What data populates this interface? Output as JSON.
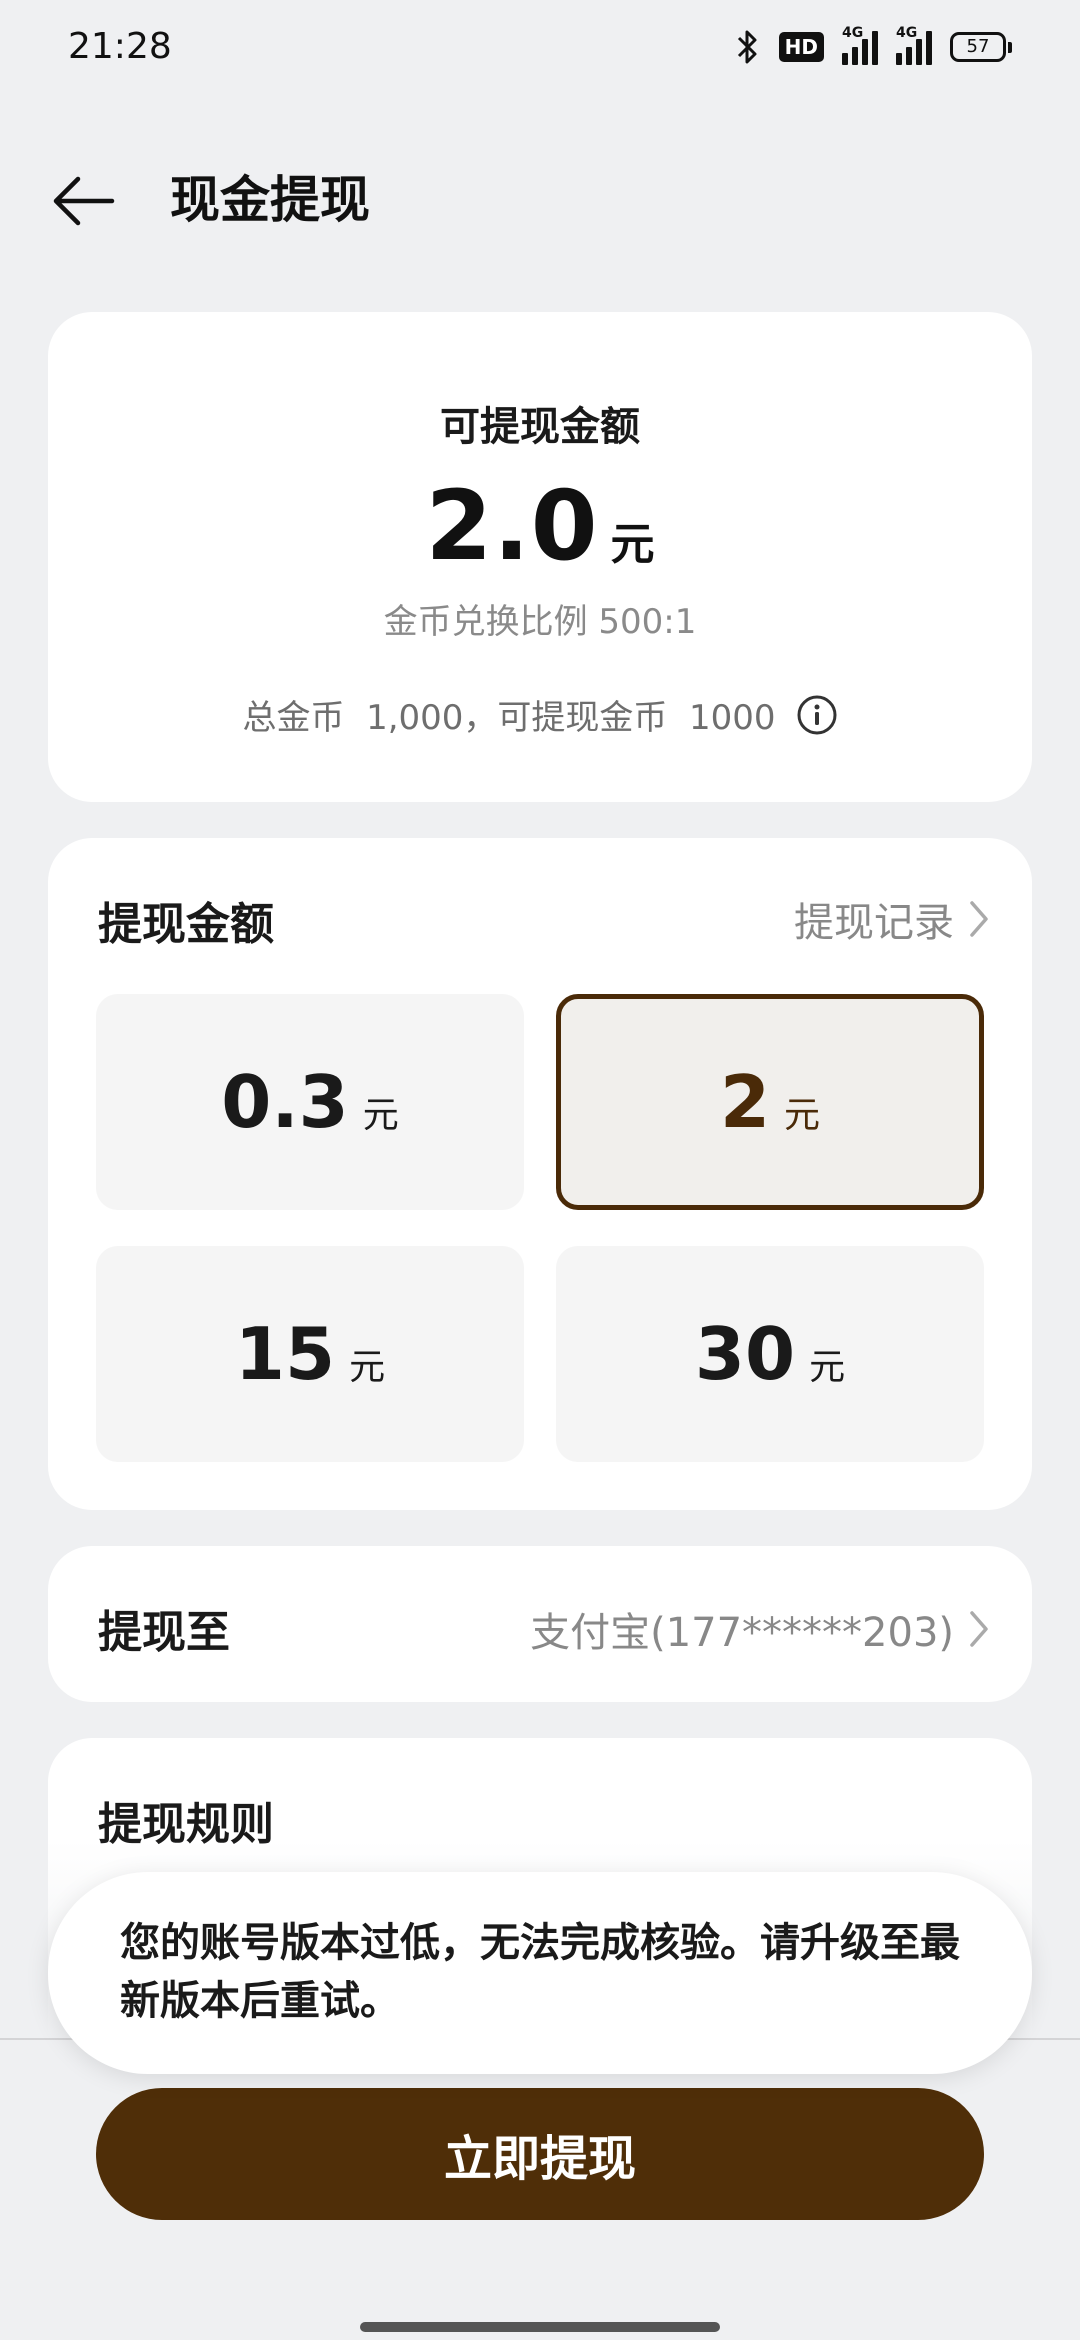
{
  "status_bar": {
    "time": "21:28",
    "hd_label": "HD",
    "net1": "4G",
    "net2": "4G",
    "battery": "57"
  },
  "header": {
    "title": "现金提现",
    "back_icon": "arrow-left-icon"
  },
  "balance": {
    "label": "可提现金额",
    "amount": "2.0",
    "unit": "元",
    "rate": "金币兑换比例 500:1",
    "coins_text": "总金币  1,000，可提现金币  1000",
    "info_icon": "info-icon"
  },
  "amount_section": {
    "title": "提现金额",
    "history_link": "提现记录",
    "options": [
      {
        "value": "0.3",
        "unit": "元",
        "selected": false
      },
      {
        "value": "2",
        "unit": "元",
        "selected": true
      },
      {
        "value": "15",
        "unit": "元",
        "selected": false
      },
      {
        "value": "30",
        "unit": "元",
        "selected": false
      }
    ]
  },
  "destination": {
    "title": "提现至",
    "value": "支付宝(177******203)"
  },
  "rules": {
    "title": "提现规则"
  },
  "toast": {
    "message": "您的账号版本过低，无法完成核验。请升级至最新版本后重试。"
  },
  "actions": {
    "withdraw_label": "立即提现"
  },
  "colors": {
    "accent": "#4f2e08",
    "background": "#eff0f2"
  }
}
